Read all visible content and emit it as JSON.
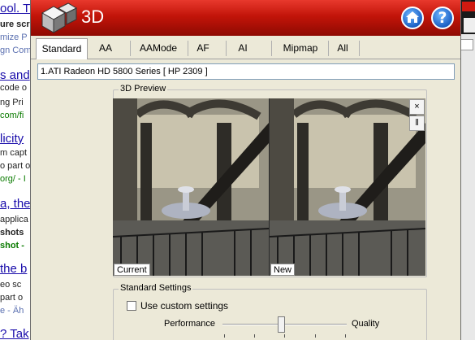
{
  "background_page": {
    "lines": [
      {
        "text": "ool. T",
        "style": "link"
      },
      {
        "text": "ure scr",
        "style": "bold"
      },
      {
        "text": "mize P",
        "style": "grey"
      },
      {
        "text": "gn Com",
        "style": "grey"
      },
      {
        "text": "s and",
        "style": "link"
      },
      {
        "text": "code o",
        "style": "text"
      },
      {
        "text": "ng Pri",
        "style": "text"
      },
      {
        "text": "com/fi",
        "style": "green"
      },
      {
        "text": "licity",
        "style": "link"
      },
      {
        "text": "m capt",
        "style": "text"
      },
      {
        "text": "o part o",
        "style": "text"
      },
      {
        "text": "org/ - I",
        "style": "green"
      },
      {
        "text": "a, the",
        "style": "link"
      },
      {
        "text": "applica",
        "style": "text"
      },
      {
        "text": "shots",
        "style": "bold"
      },
      {
        "text": "shot -",
        "style": "green"
      },
      {
        "text": "the b",
        "style": "link"
      },
      {
        "text": "eo sc",
        "style": "text"
      },
      {
        "text": "part o",
        "style": "text"
      },
      {
        "text": "e - Äh",
        "style": "grey"
      },
      {
        "text": "? Tak",
        "style": "link"
      }
    ]
  },
  "app": {
    "title": "3D",
    "tabs": [
      "Standard",
      "AA",
      "AAMode",
      "AF",
      "AI",
      "Mipmap",
      "All"
    ],
    "active_tab": "Standard",
    "device": "1.ATI Radeon HD 5800 Series [ HP 2309 ]",
    "preview": {
      "legend": "3D Preview",
      "left_label": "Current",
      "right_label": "New",
      "close_button": "×",
      "pause_button": "‖"
    },
    "standard_settings": {
      "legend": "Standard Settings",
      "custom_label": "Use custom settings",
      "custom_checked": false,
      "left_label": "Performance",
      "right_label": "Quality",
      "slider_value": 0.47
    }
  },
  "colors": {
    "titlebar": "#c21409",
    "window_bg": "#ece9d8",
    "link": "#1a0dab",
    "green_url": "#0a7b00"
  },
  "icons": {
    "logo": "cube-logo-icon",
    "home": "home-icon",
    "help": "help-icon"
  }
}
